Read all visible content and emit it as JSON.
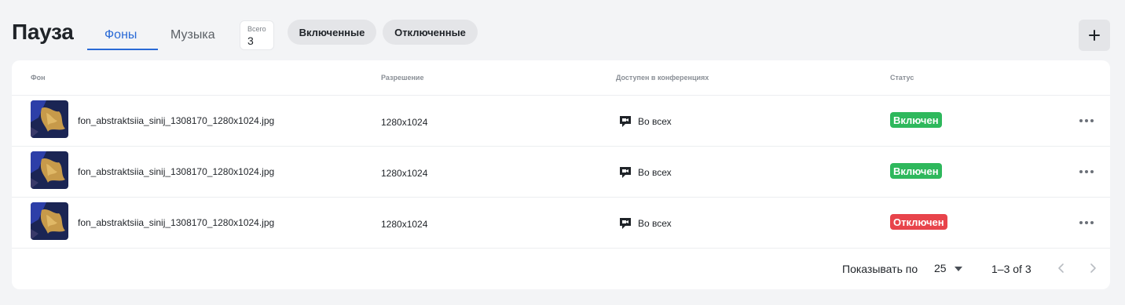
{
  "header": {
    "title": "Пауза",
    "tabs": [
      {
        "label": "Фоны",
        "active": true
      },
      {
        "label": "Музыка",
        "active": false
      }
    ],
    "total": {
      "label": "Всего",
      "value": "3"
    },
    "filters": [
      {
        "label": "Включенные"
      },
      {
        "label": "Отключенные"
      }
    ],
    "add_icon": "plus-icon"
  },
  "table": {
    "columns": [
      "Фон",
      "Разрешение",
      "Доступен в конференциях",
      "Статус"
    ],
    "rows": [
      {
        "file": "fon_abstraktsiia_sinij_1308170_1280x1024.jpg",
        "resolution": "1280x1024",
        "conferences": "Во всех",
        "status": "Включен",
        "status_color": "#2eb85c"
      },
      {
        "file": "fon_abstraktsiia_sinij_1308170_1280x1024.jpg",
        "resolution": "1280x1024",
        "conferences": "Во всех",
        "status": "Включен",
        "status_color": "#2eb85c"
      },
      {
        "file": "fon_abstraktsiia_sinij_1308170_1280x1024.jpg",
        "resolution": "1280x1024",
        "conferences": "Во всех",
        "status": "Отключен",
        "status_color": "#e8444b"
      }
    ]
  },
  "pagination": {
    "per_page_label": "Показывать по",
    "per_page": "25",
    "range": "1–3 of 3"
  },
  "colors": {
    "accent": "#2a6ad6",
    "enabled": "#2eb85c",
    "disabled": "#e8444b"
  }
}
